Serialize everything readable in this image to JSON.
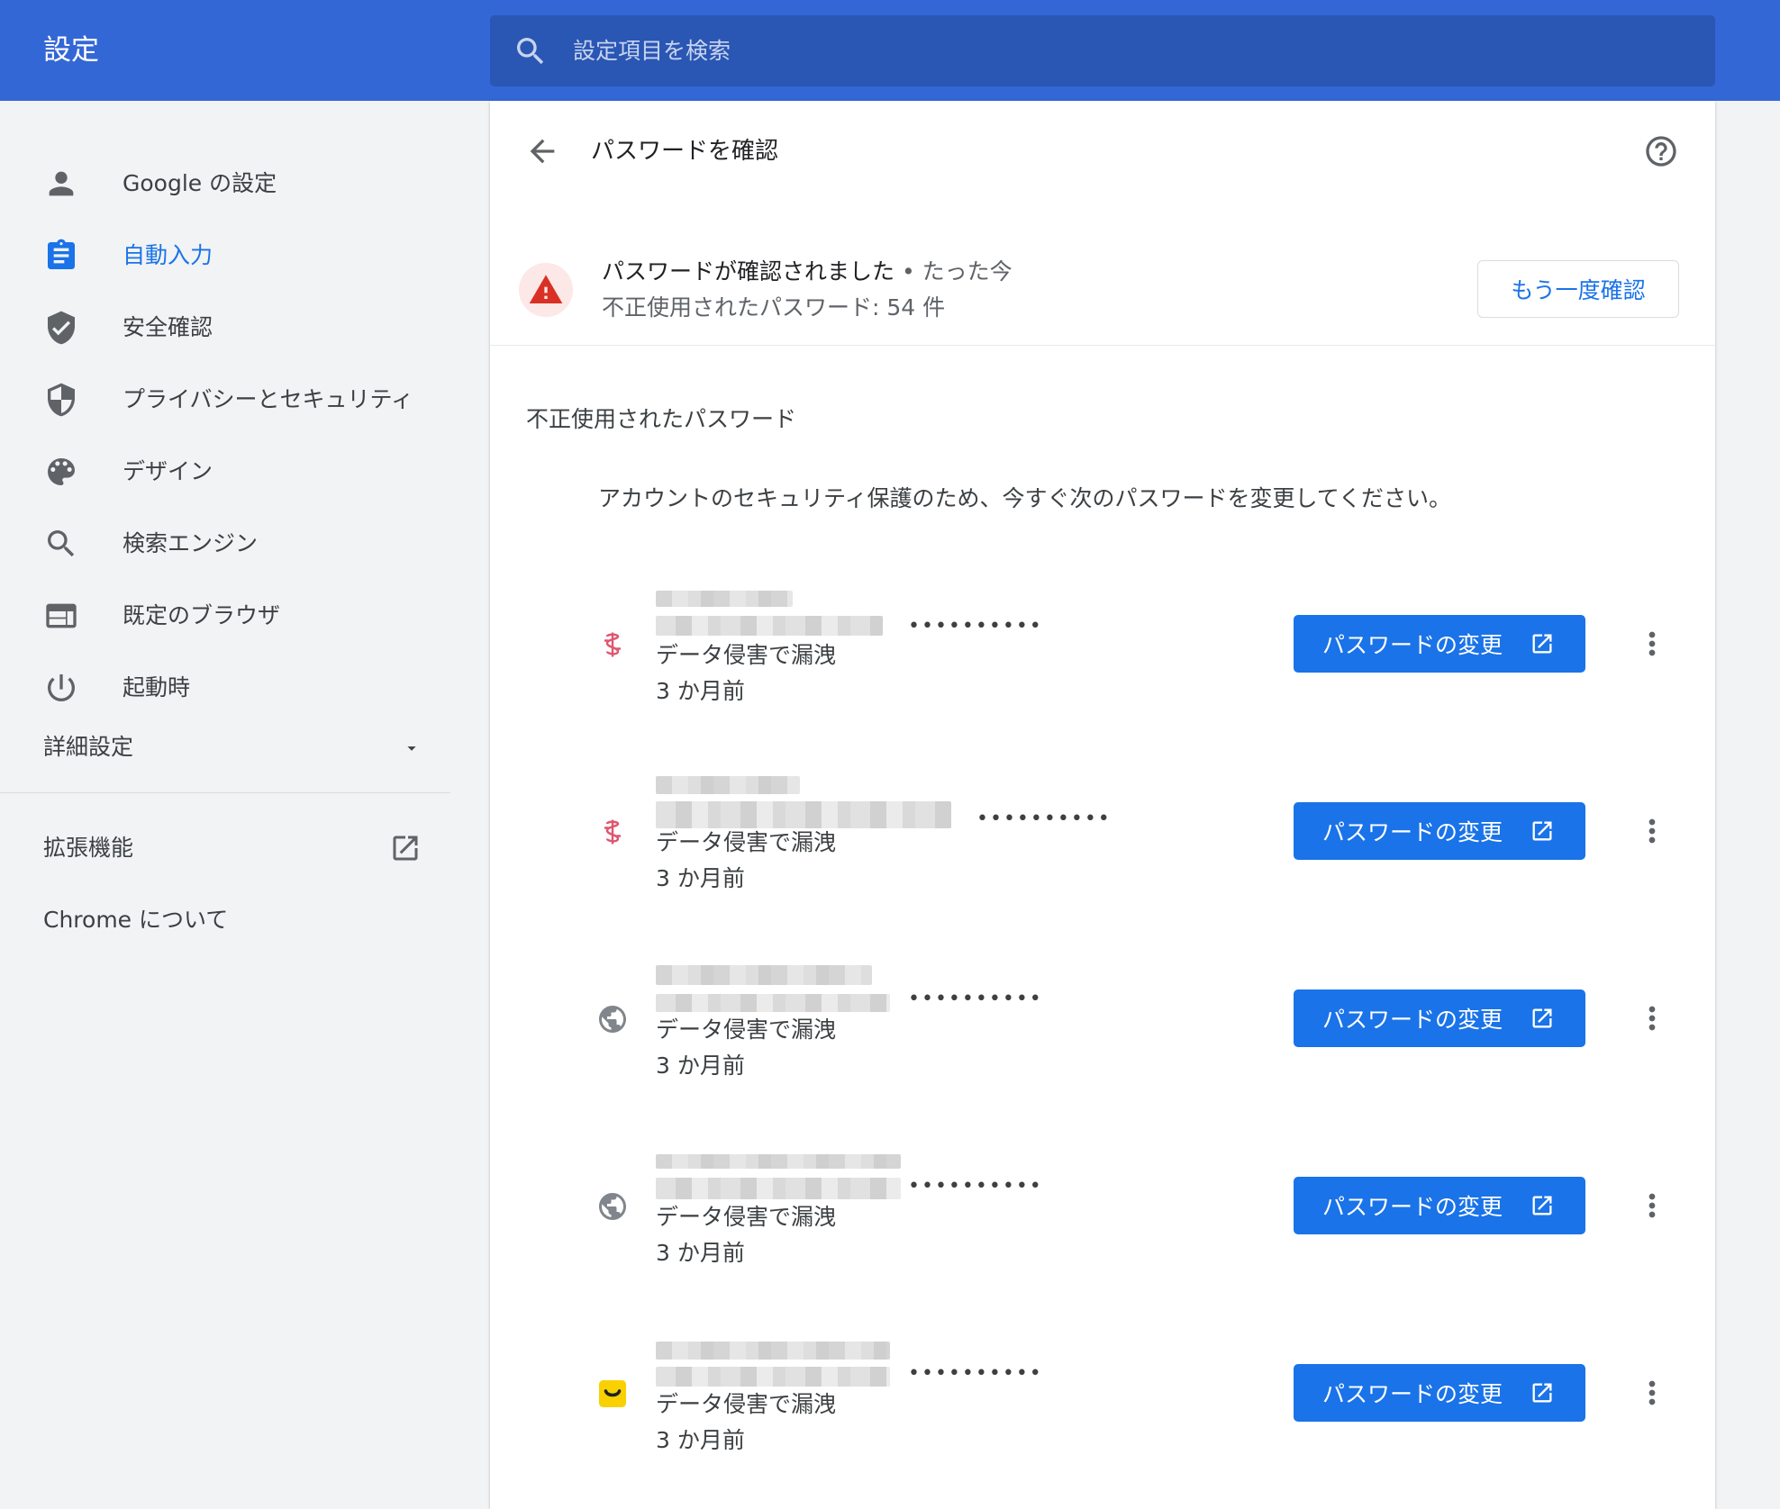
{
  "header": {
    "title": "設定",
    "search_placeholder": "設定項目を検索"
  },
  "sidebar": {
    "items": [
      {
        "label": "Google の設定",
        "icon": "person-icon"
      },
      {
        "label": "自動入力",
        "icon": "clipboard-icon",
        "active": true
      },
      {
        "label": "安全確認",
        "icon": "shield-check-icon"
      },
      {
        "label": "プライバシーとセキュリティ",
        "icon": "shield-half-icon"
      },
      {
        "label": "デザイン",
        "icon": "palette-icon"
      },
      {
        "label": "検索エンジン",
        "icon": "search-icon"
      },
      {
        "label": "既定のブラウザ",
        "icon": "browser-window-icon"
      },
      {
        "label": "起動時",
        "icon": "power-icon"
      }
    ],
    "advanced_label": "詳細設定",
    "extensions_label": "拡張機能",
    "about_label": "Chrome について"
  },
  "main": {
    "title": "パスワードを確認",
    "status": {
      "headline": "パスワードが確認されました",
      "time": " • たった今",
      "summary": "不正使用されたパスワード: 54 件"
    },
    "recheck_label": "もう一度確認",
    "section_title": "不正使用されたパスワード",
    "section_desc": "アカウントのセキュリティ保護のため、今すぐ次のパスワードを変更してください。",
    "accent_color": "#1a73e8",
    "passwords": [
      {
        "icon": "pink-site-icon",
        "masked": "••••••••••",
        "status": "データ侵害で漏洩",
        "when": "3 か月前",
        "button": "パスワードの変更"
      },
      {
        "icon": "pink-site-icon",
        "masked": "••••••••••",
        "status": "データ侵害で漏洩",
        "when": "3 か月前",
        "button": "パスワードの変更"
      },
      {
        "icon": "globe-icon",
        "masked": "••••••••••",
        "status": "データ侵害で漏洩",
        "when": "3 か月前",
        "button": "パスワードの変更"
      },
      {
        "icon": "globe-icon",
        "masked": "••••••••••",
        "status": "データ侵害で漏洩",
        "when": "3 か月前",
        "button": "パスワードの変更"
      },
      {
        "icon": "yellow-smile-icon",
        "masked": "••••••••••",
        "status": "データ侵害で漏洩",
        "when": "3 か月前",
        "button": "パスワードの変更"
      }
    ]
  }
}
